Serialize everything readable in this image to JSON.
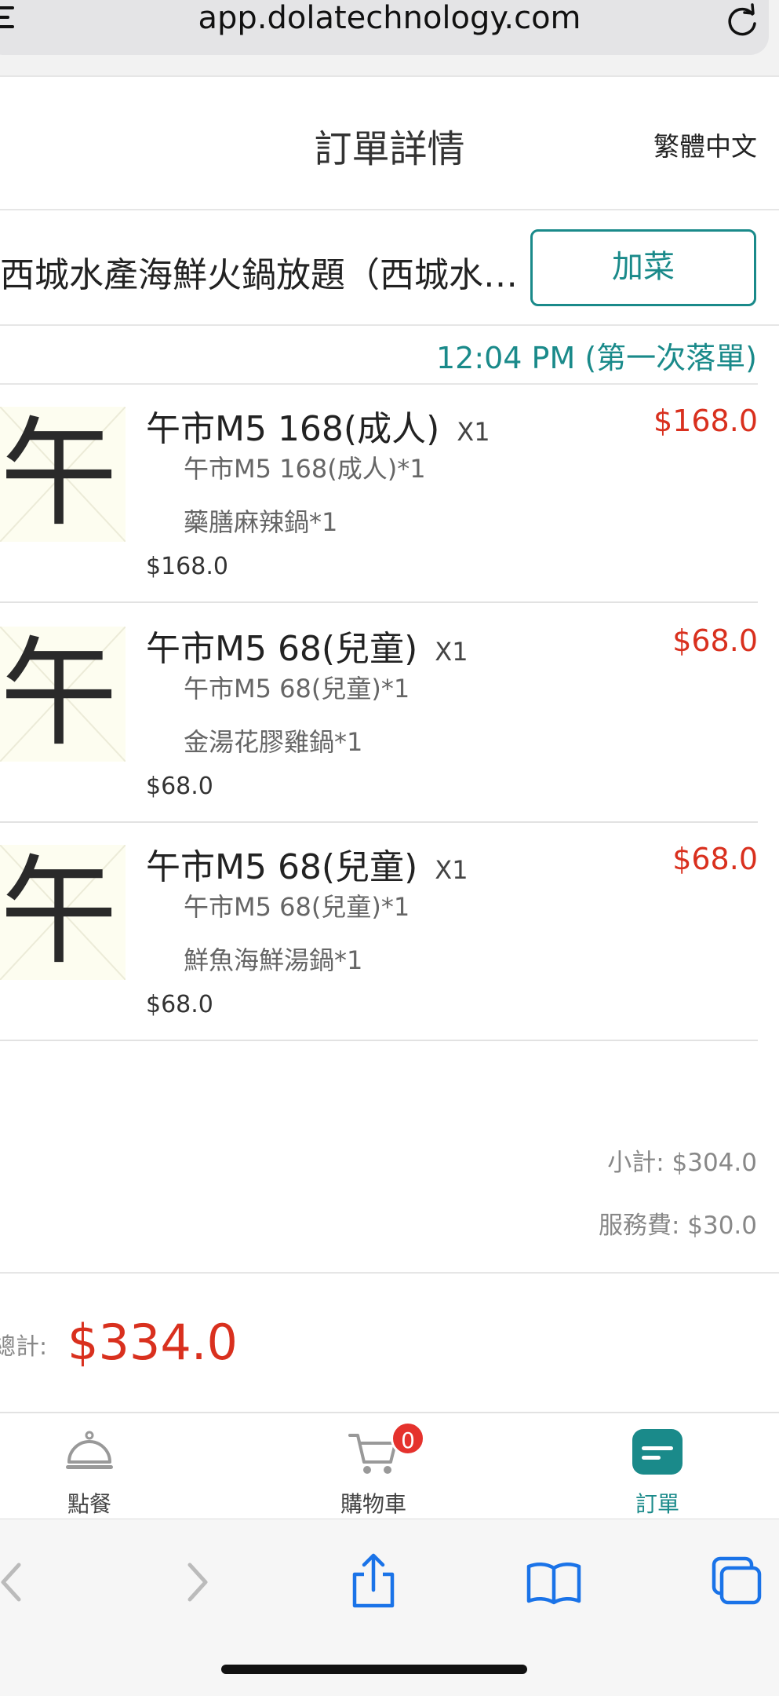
{
  "browser": {
    "url": "app.dolatechnology.com"
  },
  "header": {
    "title": "訂單詳情",
    "language": "繁體中文"
  },
  "restaurant": {
    "name": "西城水產海鮮火鍋放題（西城水…",
    "add_button": "加菜"
  },
  "order": {
    "time_label": "12:04 PM (第一次落單)",
    "items": [
      {
        "thumb_char": "午",
        "name": "午市M5 168(成人)",
        "qty": "X1",
        "price": "$168.0",
        "sub1": "午市M5 168(成人)*1",
        "sub2": "藥膳麻辣鍋*1",
        "bottom_price": "$168.0"
      },
      {
        "thumb_char": "午",
        "name": "午市M5 68(兒童)",
        "qty": "X1",
        "price": "$68.0",
        "sub1": "午市M5 68(兒童)*1",
        "sub2": "金湯花膠雞鍋*1",
        "bottom_price": "$68.0"
      },
      {
        "thumb_char": "午",
        "name": "午市M5 68(兒童)",
        "qty": "X1",
        "price": "$68.0",
        "sub1": "午市M5 68(兒童)*1",
        "sub2": "鮮魚海鮮湯鍋*1",
        "bottom_price": "$68.0"
      }
    ]
  },
  "totals": {
    "subtotal": "小計: $304.0",
    "service": "服務費: $30.0",
    "total_label": "總計:",
    "total_value": "$334.0"
  },
  "tabs": [
    {
      "label": "點餐",
      "icon": "cloche-icon"
    },
    {
      "label": "購物車",
      "icon": "cart-icon",
      "badge": "0"
    },
    {
      "label": "訂單",
      "icon": "order-icon"
    }
  ],
  "colors": {
    "accent": "#1a8a8a",
    "price": "#d9301e",
    "badge": "#e5322d"
  }
}
